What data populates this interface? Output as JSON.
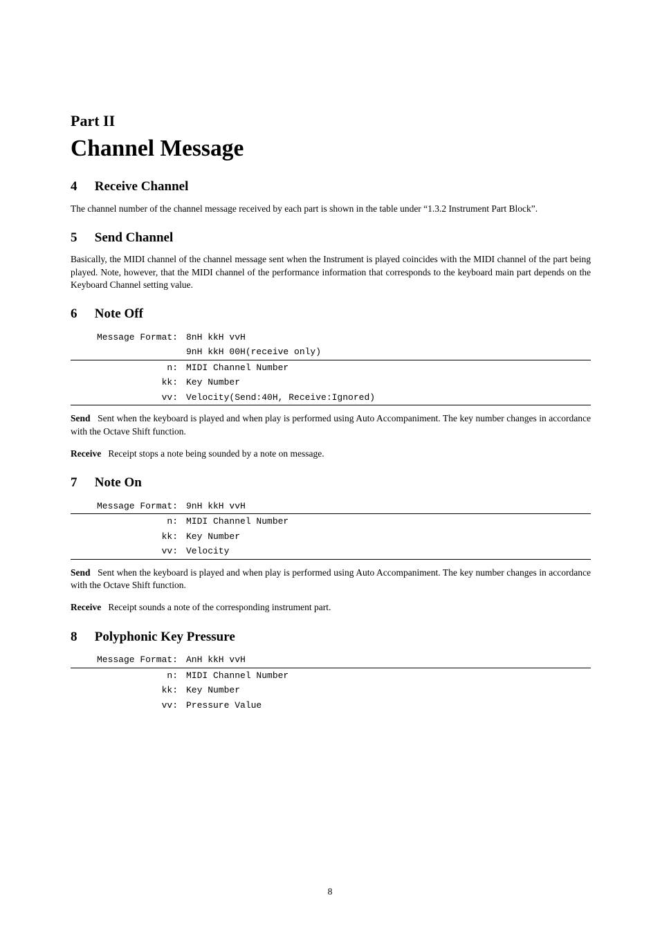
{
  "part": {
    "label": "Part II",
    "title": "Channel Message"
  },
  "sections": {
    "s4": {
      "num": "4",
      "title": "Receive Channel",
      "body": "The channel number of the channel message received by each part is shown in the table under “1.3.2 Instrument Part Block”."
    },
    "s5": {
      "num": "5",
      "title": "Send Channel",
      "body": "Basically, the MIDI channel of the channel message sent when the Instrument is played coincides with the MIDI channel of the part being played. Note, however, that the MIDI channel of the performance information that corresponds to the keyboard main part depends on the Keyboard Channel setting value."
    },
    "s6": {
      "num": "6",
      "title": "Note Off",
      "format_label": "Message Format:",
      "format_line1": "8nH kkH vvH",
      "format_line2": "9nH kkH 00H(receive only)",
      "rows": {
        "n_label": "n:",
        "n_value": "MIDI Channel Number",
        "kk_label": "kk:",
        "kk_value": "Key Number",
        "vv_label": "vv:",
        "vv_value": "Velocity(Send:40H, Receive:Ignored)"
      },
      "send_lead": "Send",
      "send_body": "Sent when the keyboard is played and when play is performed using Auto Accompaniment. The key number changes in accordance with the Octave Shift function.",
      "receive_lead": "Receive",
      "receive_body": "Receipt stops a note being sounded by a note on message."
    },
    "s7": {
      "num": "7",
      "title": "Note On",
      "format_label": "Message Format:",
      "format_line1": "9nH kkH vvH",
      "rows": {
        "n_label": "n:",
        "n_value": "MIDI Channel Number",
        "kk_label": "kk:",
        "kk_value": "Key Number",
        "vv_label": "vv:",
        "vv_value": "Velocity"
      },
      "send_lead": "Send",
      "send_body": "Sent when the keyboard is played and when play is performed using Auto Accompaniment. The key number changes in accordance with the Octave Shift function.",
      "receive_lead": "Receive",
      "receive_body": "Receipt sounds a note of the corresponding instrument part."
    },
    "s8": {
      "num": "8",
      "title": "Polyphonic Key Pressure",
      "format_label": "Message Format:",
      "format_line1": "AnH kkH vvH",
      "rows": {
        "n_label": "n:",
        "n_value": "MIDI Channel Number",
        "kk_label": "kk:",
        "kk_value": "Key Number",
        "vv_label": "vv:",
        "vv_value": "Pressure Value"
      }
    }
  },
  "page_number": "8"
}
